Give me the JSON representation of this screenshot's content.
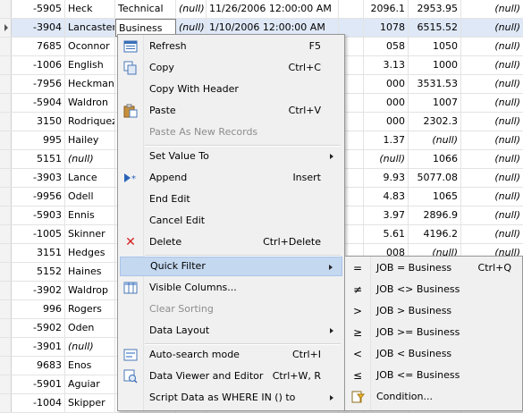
{
  "grid": {
    "rows": [
      {
        "c0": "-5905",
        "c1": "Heck",
        "c2": "Technical",
        "c3": "(null)",
        "c4": "11/26/2006 12:00:00 AM",
        "c5": "",
        "c6": "2096.1",
        "c7": "2953.95",
        "c8": "(null)"
      },
      {
        "c0": "-3904",
        "c1": "Lancaster",
        "c2": "Business",
        "c3": "(null)",
        "c4": "1/10/2006 12:00:00 AM",
        "c5": "",
        "c6": "1078",
        "c7": "6515.52",
        "c8": "(null)"
      },
      {
        "c0": "7685",
        "c1": "Oconnor",
        "c2": "",
        "c3": "",
        "c4": "",
        "c5": "",
        "c6": "058",
        "c7": "1050",
        "c8": "(null)"
      },
      {
        "c0": "-1006",
        "c1": "English",
        "c2": "",
        "c3": "",
        "c4": "",
        "c5": "",
        "c6": "3.13",
        "c7": "1000",
        "c8": "(null)"
      },
      {
        "c0": "-7956",
        "c1": "Heckman",
        "c2": "",
        "c3": "",
        "c4": "",
        "c5": "",
        "c6": "000",
        "c7": "3531.53",
        "c8": "(null)"
      },
      {
        "c0": "-5904",
        "c1": "Waldron",
        "c2": "",
        "c3": "",
        "c4": "",
        "c5": "",
        "c6": "000",
        "c7": "1007",
        "c8": "(null)"
      },
      {
        "c0": "3150",
        "c1": "Rodriquez",
        "c2": "",
        "c3": "",
        "c4": "",
        "c5": "",
        "c6": "000",
        "c7": "2302.3",
        "c8": "(null)"
      },
      {
        "c0": "995",
        "c1": "Hailey",
        "c2": "",
        "c3": "",
        "c4": "",
        "c5": "",
        "c6": "1.37",
        "c7": "(null)",
        "c8": "(null)"
      },
      {
        "c0": "5151",
        "c1": "(null)",
        "c2": "",
        "c3": "",
        "c4": "",
        "c5": "",
        "c6": "(null)",
        "c7": "1066",
        "c8": "(null)"
      },
      {
        "c0": "-3903",
        "c1": "Lance",
        "c2": "",
        "c3": "",
        "c4": "",
        "c5": "",
        "c6": "9.93",
        "c7": "5077.08",
        "c8": "(null)"
      },
      {
        "c0": "-9956",
        "c1": "Odell",
        "c2": "",
        "c3": "",
        "c4": "",
        "c5": "",
        "c6": "4.83",
        "c7": "1065",
        "c8": "(null)"
      },
      {
        "c0": "-5903",
        "c1": "Ennis",
        "c2": "",
        "c3": "",
        "c4": "",
        "c5": "",
        "c6": "3.97",
        "c7": "2896.9",
        "c8": "(null)"
      },
      {
        "c0": "-1005",
        "c1": "Skinner",
        "c2": "",
        "c3": "",
        "c4": "",
        "c5": "",
        "c6": "5.61",
        "c7": "4196.2",
        "c8": "(null)"
      },
      {
        "c0": "3151",
        "c1": "Hedges",
        "c2": "",
        "c3": "",
        "c4": "",
        "c5": "",
        "c6": "008",
        "c7": "(null)",
        "c8": "(null)"
      },
      {
        "c0": "5152",
        "c1": "Haines",
        "c2": "",
        "c3": "",
        "c4": "",
        "c5": "",
        "c6": "",
        "c7": "",
        "c8": ""
      },
      {
        "c0": "-3902",
        "c1": "Waldrop",
        "c2": "",
        "c3": "",
        "c4": "",
        "c5": "",
        "c6": "",
        "c7": "",
        "c8": ""
      },
      {
        "c0": "996",
        "c1": "Rogers",
        "c2": "",
        "c3": "",
        "c4": "",
        "c5": "",
        "c6": "",
        "c7": "",
        "c8": ""
      },
      {
        "c0": "-5902",
        "c1": "Oden",
        "c2": "",
        "c3": "",
        "c4": "",
        "c5": "",
        "c6": "",
        "c7": "",
        "c8": ""
      },
      {
        "c0": "-3901",
        "c1": "(null)",
        "c2": "",
        "c3": "",
        "c4": "",
        "c5": "",
        "c6": "",
        "c7": "",
        "c8": ""
      },
      {
        "c0": "9683",
        "c1": "Enos",
        "c2": "",
        "c3": "",
        "c4": "",
        "c5": "",
        "c6": "",
        "c7": "",
        "c8": ""
      },
      {
        "c0": "-5901",
        "c1": "Aguiar",
        "c2": "",
        "c3": "",
        "c4": "",
        "c5": "",
        "c6": "",
        "c7": "",
        "c8": ""
      },
      {
        "c0": "-1004",
        "c1": "Skipper",
        "c2": "",
        "c3": "",
        "c4": "",
        "c5": "",
        "c6": "",
        "c7": "",
        "c8": ""
      }
    ]
  },
  "context_menu": {
    "refresh": {
      "label": "Refresh",
      "shortcut": "F5"
    },
    "copy": {
      "label": "Copy",
      "shortcut": "Ctrl+C"
    },
    "copy_with_header": {
      "label": "Copy With Header"
    },
    "paste": {
      "label": "Paste",
      "shortcut": "Ctrl+V"
    },
    "paste_as_new": {
      "label": "Paste As New Records"
    },
    "set_value_to": {
      "label": "Set Value To"
    },
    "append": {
      "label": "Append",
      "shortcut": "Insert"
    },
    "end_edit": {
      "label": "End Edit"
    },
    "cancel_edit": {
      "label": "Cancel Edit"
    },
    "delete": {
      "label": "Delete",
      "shortcut": "Ctrl+Delete"
    },
    "quick_filter": {
      "label": "Quick Filter"
    },
    "visible_columns": {
      "label": "Visible Columns..."
    },
    "clear_sorting": {
      "label": "Clear Sorting"
    },
    "data_layout": {
      "label": "Data Layout"
    },
    "auto_search": {
      "label": "Auto-search mode",
      "shortcut": "Ctrl+I"
    },
    "data_viewer": {
      "label": "Data Viewer and Editor",
      "shortcut": "Ctrl+W, R"
    },
    "script_data": {
      "label": "Script Data as WHERE IN () to"
    }
  },
  "quick_filter_menu": {
    "eq": {
      "icon": "=",
      "label": "JOB = Business",
      "shortcut": "Ctrl+Q"
    },
    "ne": {
      "icon": "≠",
      "label": "JOB <> Business"
    },
    "gt": {
      "icon": ">",
      "label": "JOB > Business"
    },
    "ge": {
      "icon": "≥",
      "label": "JOB >= Business"
    },
    "lt": {
      "icon": "<",
      "label": "JOB < Business"
    },
    "le": {
      "icon": "≤",
      "label": "JOB <= Business"
    },
    "condition": {
      "label": "Condition..."
    }
  }
}
